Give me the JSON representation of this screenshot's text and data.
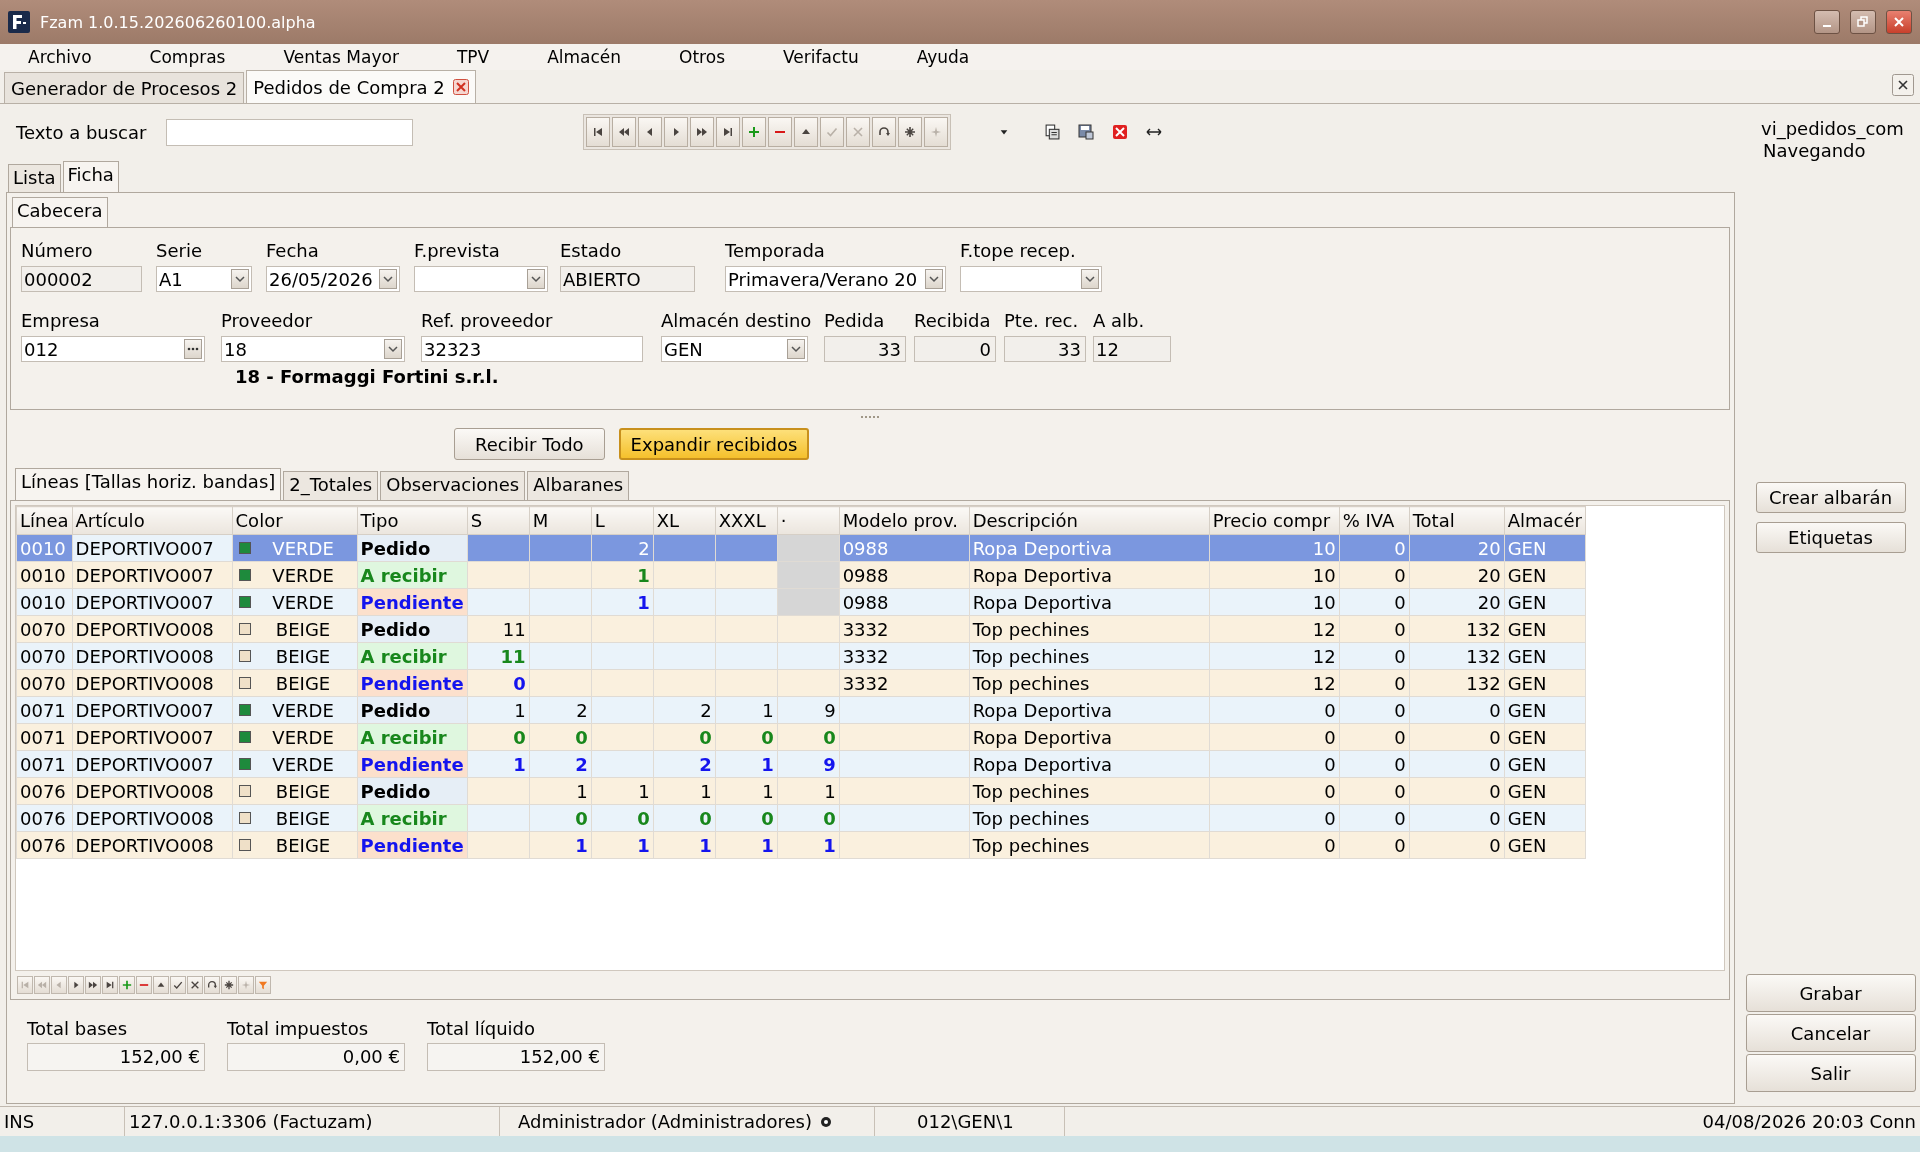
{
  "window": {
    "title": "Fzam 1.0.15.202606260100.alpha"
  },
  "menu": [
    "Archivo",
    "Compras",
    "Ventas Mayor",
    "TPV",
    "Almacén",
    "Otros",
    "Verifactu",
    "Ayuda"
  ],
  "doc_tabs": [
    {
      "label": "Generador de Procesos 2",
      "selected": false
    },
    {
      "label": "Pedidos de Compra 2",
      "selected": true
    }
  ],
  "search": {
    "label": "Texto a buscar"
  },
  "toolbar": [
    {
      "kind": "first",
      "disabled": false
    },
    {
      "kind": "prev_page",
      "disabled": false
    },
    {
      "kind": "prev",
      "disabled": false
    },
    {
      "kind": "next",
      "disabled": false
    },
    {
      "kind": "next_page",
      "disabled": false
    },
    {
      "kind": "last",
      "disabled": false
    },
    {
      "kind": "add",
      "disabled": false
    },
    {
      "kind": "delete",
      "disabled": false
    },
    {
      "kind": "up",
      "disabled": false
    },
    {
      "kind": "confirm",
      "disabled": true
    },
    {
      "kind": "cancel",
      "disabled": true
    },
    {
      "kind": "refresh",
      "disabled": false
    },
    {
      "kind": "insert",
      "disabled": false
    },
    {
      "kind": "sparkle",
      "disabled": true
    }
  ],
  "extra_tools": [
    {
      "kind": "caret"
    },
    {
      "kind": "copy"
    },
    {
      "kind": "save"
    },
    {
      "kind": "remove"
    },
    {
      "kind": "swap"
    }
  ],
  "view_info": {
    "view": "vi_pedidos_com",
    "mode": "Navegando"
  },
  "view_tabs": [
    {
      "label": "Lista",
      "selected": false
    },
    {
      "label": "Ficha",
      "selected": true
    }
  ],
  "header_tabs": [
    {
      "label": "Cabecera",
      "selected": true
    }
  ],
  "header_rows": [
    [
      {
        "label": "Número",
        "value": "000002",
        "kind": "readonly"
      },
      {
        "label": "Serie",
        "value": "A1",
        "kind": "combo"
      },
      {
        "label": "Fecha",
        "value": "26/05/2026",
        "kind": "combo"
      },
      {
        "label": "F.prevista",
        "kind": "combo"
      },
      {
        "label": "Estado",
        "value": "ABIERTO",
        "kind": "readonly"
      },
      {
        "label": "Temporada",
        "value": "Primavera/Verano 20",
        "kind": "combo"
      },
      {
        "label": "F.tope recep.",
        "kind": "combo"
      }
    ],
    [
      {
        "label": "Empresa",
        "value": "012",
        "kind": "lookup"
      },
      {
        "label": "Proveedor",
        "value": "18",
        "kind": "combo"
      },
      {
        "label": "Ref. proveedor",
        "value": "32323",
        "kind": "text"
      },
      {
        "label": "Almacén destino",
        "value": "GEN",
        "kind": "combo"
      },
      {
        "label": "Pedida",
        "value": "33",
        "kind": "number"
      },
      {
        "label": "Recibida",
        "value": "0",
        "kind": "number"
      },
      {
        "label": "Pte. rec.",
        "value": "33",
        "kind": "number"
      },
      {
        "label": "A alb.",
        "value": "12",
        "kind": "readonly"
      }
    ]
  ],
  "provider_name": "18 - Formaggi Fortini s.r.l.",
  "action_buttons": [
    {
      "label": "Recibir Todo",
      "highlighted": false
    },
    {
      "label": "Expandir recibidos",
      "highlighted": true
    }
  ],
  "line_tabs": [
    {
      "label": "Líneas [Tallas horiz. bandas]",
      "selected": true
    },
    {
      "label": "2_Totales",
      "selected": false
    },
    {
      "label": "Observaciones",
      "selected": false
    },
    {
      "label": "Albaranes",
      "selected": false
    }
  ],
  "table": {
    "columns": [
      "Línea",
      "Artículo",
      "Color",
      "Tipo",
      "S",
      "M",
      "L",
      "XL",
      "XXXL",
      "·",
      "Modelo prov.",
      "Descripción",
      "Precio compr",
      "% IVA",
      "Total",
      "Almacér"
    ],
    "rows": [
      {
        "selected": true,
        "linea": "0010",
        "articulo": "DEPORTIVO007",
        "color": "#1e8a3c",
        "color_name": "VERDE",
        "tipo": "Pedido",
        "kind": "pedido",
        "sizes": {
          "l": "2"
        },
        "last_greyed": true,
        "modelo": "0988",
        "descripcion": "Ropa Deportiva",
        "precio": "10",
        "iva": "0",
        "total": "20",
        "almacen": "GEN"
      },
      {
        "selected": false,
        "linea": "0010",
        "articulo": "DEPORTIVO007",
        "color": "#1e8a3c",
        "color_name": "VERDE",
        "tipo": "A recibir",
        "kind": "a_recibir",
        "sizes": {
          "l": "1"
        },
        "last_greyed": true,
        "modelo": "0988",
        "descripcion": "Ropa Deportiva",
        "precio": "10",
        "iva": "0",
        "total": "20",
        "almacen": "GEN"
      },
      {
        "selected": false,
        "linea": "0010",
        "articulo": "DEPORTIVO007",
        "color": "#1e8a3c",
        "color_name": "VERDE",
        "tipo": "Pendiente",
        "kind": "pendiente",
        "sizes": {
          "l": "1"
        },
        "last_greyed": true,
        "modelo": "0988",
        "descripcion": "Ropa Deportiva",
        "precio": "10",
        "iva": "0",
        "total": "20",
        "almacen": "GEN"
      },
      {
        "selected": false,
        "linea": "0070",
        "articulo": "DEPORTIVO008",
        "color": "#efe0c8",
        "color_name": "BEIGE",
        "tipo": "Pedido",
        "kind": "pedido",
        "sizes": {
          "s": "11"
        },
        "last_greyed": false,
        "modelo": "3332",
        "descripcion": "Top pechines",
        "precio": "12",
        "iva": "0",
        "total": "132",
        "almacen": "GEN"
      },
      {
        "selected": false,
        "linea": "0070",
        "articulo": "DEPORTIVO008",
        "color": "#efe0c8",
        "color_name": "BEIGE",
        "tipo": "A recibir",
        "kind": "a_recibir",
        "sizes": {
          "s": "11"
        },
        "last_greyed": false,
        "modelo": "3332",
        "descripcion": "Top pechines",
        "precio": "12",
        "iva": "0",
        "total": "132",
        "almacen": "GEN"
      },
      {
        "selected": false,
        "linea": "0070",
        "articulo": "DEPORTIVO008",
        "color": "#efe0c8",
        "color_name": "BEIGE",
        "tipo": "Pendiente",
        "kind": "pendiente",
        "sizes": {
          "s": "0"
        },
        "last_greyed": false,
        "modelo": "3332",
        "descripcion": "Top pechines",
        "precio": "12",
        "iva": "0",
        "total": "132",
        "almacen": "GEN"
      },
      {
        "selected": false,
        "linea": "0071",
        "articulo": "DEPORTIVO007",
        "color": "#1e8a3c",
        "color_name": "VERDE",
        "tipo": "Pedido",
        "kind": "pedido",
        "sizes": {
          "s": "1",
          "m": "2",
          "xl": "2",
          "xxxl": "1",
          "extra": "9"
        },
        "last_greyed": false,
        "descripcion": "Ropa Deportiva",
        "precio": "0",
        "iva": "0",
        "total": "0",
        "almacen": "GEN"
      },
      {
        "selected": false,
        "linea": "0071",
        "articulo": "DEPORTIVO007",
        "color": "#1e8a3c",
        "color_name": "VERDE",
        "tipo": "A recibir",
        "kind": "a_recibir",
        "sizes": {
          "s": "0",
          "m": "0",
          "xl": "0",
          "xxxl": "0",
          "extra": "0"
        },
        "last_greyed": false,
        "descripcion": "Ropa Deportiva",
        "precio": "0",
        "iva": "0",
        "total": "0",
        "almacen": "GEN"
      },
      {
        "selected": false,
        "linea": "0071",
        "articulo": "DEPORTIVO007",
        "color": "#1e8a3c",
        "color_name": "VERDE",
        "tipo": "Pendiente",
        "kind": "pendiente",
        "sizes": {
          "s": "1",
          "m": "2",
          "xl": "2",
          "xxxl": "1",
          "extra": "9"
        },
        "last_greyed": false,
        "descripcion": "Ropa Deportiva",
        "precio": "0",
        "iva": "0",
        "total": "0",
        "almacen": "GEN"
      },
      {
        "selected": false,
        "linea": "0076",
        "articulo": "DEPORTIVO008",
        "color": "#efe0c8",
        "color_name": "BEIGE",
        "tipo": "Pedido",
        "kind": "pedido",
        "sizes": {
          "m": "1",
          "l": "1",
          "xl": "1",
          "xxxl": "1",
          "extra": "1"
        },
        "last_greyed": false,
        "descripcion": "Top pechines",
        "precio": "0",
        "iva": "0",
        "total": "0",
        "almacen": "GEN"
      },
      {
        "selected": false,
        "linea": "0076",
        "articulo": "DEPORTIVO008",
        "color": "#efe0c8",
        "color_name": "BEIGE",
        "tipo": "A recibir",
        "kind": "a_recibir",
        "sizes": {
          "m": "0",
          "l": "0",
          "xl": "0",
          "xxxl": "0",
          "extra": "0"
        },
        "last_greyed": false,
        "descripcion": "Top pechines",
        "precio": "0",
        "iva": "0",
        "total": "0",
        "almacen": "GEN"
      },
      {
        "selected": false,
        "linea": "0076",
        "articulo": "DEPORTIVO008",
        "color": "#efe0c8",
        "color_name": "BEIGE",
        "tipo": "Pendiente",
        "kind": "pendiente",
        "sizes": {
          "m": "1",
          "l": "1",
          "xl": "1",
          "xxxl": "1",
          "extra": "1"
        },
        "last_greyed": false,
        "descripcion": "Top pechines",
        "precio": "0",
        "iva": "0",
        "total": "0",
        "almacen": "GEN"
      }
    ]
  },
  "grid_toolbar": [
    {
      "kind": "first",
      "disabled": true
    },
    {
      "kind": "prev_page",
      "disabled": true
    },
    {
      "kind": "prev",
      "disabled": true
    },
    {
      "kind": "next",
      "disabled": false
    },
    {
      "kind": "next_page",
      "disabled": false
    },
    {
      "kind": "last",
      "disabled": false
    },
    {
      "kind": "add",
      "disabled": false
    },
    {
      "kind": "delete",
      "disabled": false
    },
    {
      "kind": "up",
      "disabled": false
    },
    {
      "kind": "confirm",
      "disabled": false
    },
    {
      "kind": "cancel",
      "disabled": false
    },
    {
      "kind": "refresh",
      "disabled": false
    },
    {
      "kind": "insert",
      "disabled": false
    },
    {
      "kind": "sparkle",
      "disabled": true
    },
    {
      "kind": "filter",
      "disabled": false
    }
  ],
  "totals": [
    {
      "label": "Total bases",
      "value": "152,00 €"
    },
    {
      "label": "Total impuestos",
      "value": "0,00 €"
    },
    {
      "label": "Total líquido",
      "value": "152,00 €"
    }
  ],
  "side_buttons": [
    "Crear albarán",
    "Etiquetas"
  ],
  "form_buttons": [
    "Grabar",
    "Cancelar",
    "Salir"
  ],
  "status_bar": {
    "mode": "INS",
    "server": "127.0.0.1:3306 (Factuzam)",
    "user": "Administrador (Administradores)",
    "location": "012\\GEN\\1",
    "datetime": "04/08/2026 20:03 Conn"
  }
}
